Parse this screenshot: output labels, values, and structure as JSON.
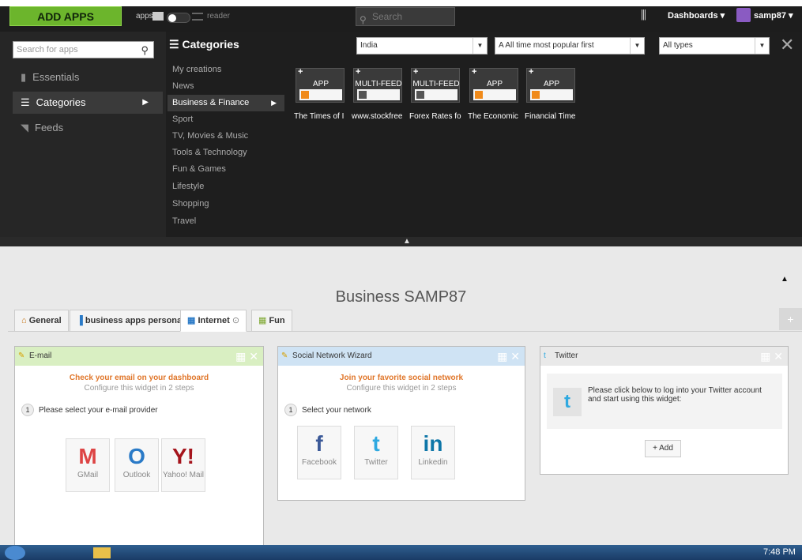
{
  "topbar": {
    "add_apps": "ADD APPS",
    "apps_label": "apps",
    "reader_label": "reader",
    "search_placeholder": "Search",
    "dashboards": "Dashboards ▾",
    "user": "samp87 ▾"
  },
  "left_nav": {
    "search_placeholder": "Search for apps",
    "items": [
      "Essentials",
      "Categories",
      "Feeds"
    ]
  },
  "categories": {
    "title": "Categories",
    "items": [
      "My creations",
      "News",
      "Business & Finance",
      "Sport",
      "TV, Movies & Music",
      "Tools & Technology",
      "Fun & Games",
      "Lifestyle",
      "Shopping",
      "Travel"
    ],
    "selected": "Business & Finance"
  },
  "filters": {
    "country": "India",
    "sort": "All time most popular first",
    "sort_prefix": "A",
    "type": "All types"
  },
  "apps": [
    {
      "kind": "APP",
      "label": "The Times of I"
    },
    {
      "kind": "MULTI-FEED",
      "label": "www.stockfree"
    },
    {
      "kind": "MULTI-FEED",
      "label": "Forex Rates fo"
    },
    {
      "kind": "APP",
      "label": "The Economic"
    },
    {
      "kind": "APP",
      "label": "Financial Time"
    }
  ],
  "dashboard": {
    "title": "Business SAMP87",
    "tabs": [
      "General",
      "business apps personal",
      "Internet",
      "Fun"
    ],
    "active_tab": "Internet"
  },
  "widgets": {
    "email": {
      "title": "E-mail",
      "headline": "Check your email on your dashboard",
      "sub": "Configure this widget in 2 steps",
      "step": "Please select your e-mail provider",
      "providers": [
        "GMail",
        "Outlook",
        "Yahoo! Mail"
      ]
    },
    "social": {
      "title": "Social Network Wizard",
      "headline": "Join your favorite social network",
      "sub": "Configure this widget in 2 steps",
      "step": "Select your network",
      "networks": [
        "Facebook",
        "Twitter",
        "Linkedin"
      ]
    },
    "twitter": {
      "title": "Twitter",
      "message": "Please click below to log into your Twitter account and start using this widget:",
      "add": "+ Add"
    }
  },
  "taskbar": {
    "clock": "7:48 PM"
  },
  "colors": {
    "accent_green": "#6cb52c",
    "email_head": "#d9efc2",
    "social_head": "#cfe3f4",
    "twitter_head": "#e9e9e9"
  }
}
